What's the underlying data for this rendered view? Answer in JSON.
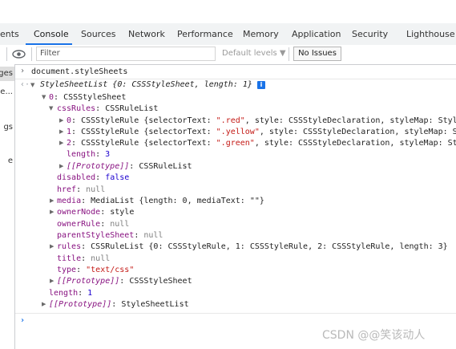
{
  "tabs": [
    "ents",
    "Console",
    "Sources",
    "Network",
    "Performance",
    "Memory",
    "Application",
    "Security",
    "Lighthouse"
  ],
  "active_tab": "Console",
  "toolbar": {
    "filter_placeholder": "Filter",
    "levels_label": "Default levels ▼",
    "issues_label": "No Issues"
  },
  "sidebar": {
    "items": [
      "ges",
      "e...",
      "gs",
      "e"
    ]
  },
  "console": {
    "input_command": "document.styleSheets",
    "output_summary": "StyleSheetList {0: CSSStyleSheet, length: 1}",
    "sheet0_label": "0: CSSStyleSheet",
    "cssRules_label": "cssRules: CSSRuleList",
    "rule0": {
      "key": "0",
      "type": "CSSStyleRule",
      "selector": "\".red\"",
      "rest": ", style: CSSStyleDeclaration, styleMap: Style"
    },
    "rule1": {
      "key": "1",
      "type": "CSSStyleRule",
      "selector": "\".yellow\"",
      "rest": ", style: CSSStyleDeclaration, styleMap: St"
    },
    "rule2": {
      "key": "2",
      "type": "CSSStyleRule",
      "selector": "\".green\"",
      "rest": ", style: CSSStyleDeclaration, styleMap: Sty"
    },
    "rules_length": "3",
    "rules_proto": "CSSRuleList",
    "disabled": "false",
    "href": "null",
    "media": "MediaList {length: 0, mediaText: \"\"}",
    "ownerNode": "style",
    "ownerRule": "null",
    "parentStyleSheet": "null",
    "rules": "CSSRuleList {0: CSSStyleRule, 1: CSSStyleRule, 2: CSSStyleRule, length: 3}",
    "title": "null",
    "type": "\"text/css\"",
    "sheet_proto": "CSSStyleSheet",
    "list_length": "1",
    "list_proto": "StyleSheetList"
  },
  "watermark": "CSDN @@笑该动人",
  "colors": {
    "accent": "#1a73e8",
    "key": "#881280",
    "string": "#c41a16",
    "number": "#1c00cf",
    "null": "#808080"
  }
}
